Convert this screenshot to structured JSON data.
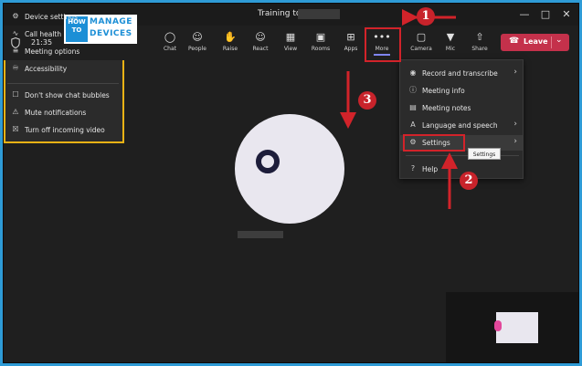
{
  "window": {
    "title": "Training to",
    "controls": [
      "minimize-icon",
      "maximize-icon",
      "close-icon"
    ]
  },
  "branding": {
    "logo_left": "HOW TO",
    "logo_top": "MANAGE",
    "logo_bottom": "DEVICES"
  },
  "toolbar": {
    "clock": "21:35",
    "buttons": [
      {
        "label": "Chat",
        "icon": "chat-icon"
      },
      {
        "label": "People",
        "icon": "people-icon"
      },
      {
        "label": "Raise",
        "icon": "hand-icon"
      },
      {
        "label": "React",
        "icon": "smile-icon"
      },
      {
        "label": "View",
        "icon": "grid-icon"
      },
      {
        "label": "Rooms",
        "icon": "rooms-icon"
      },
      {
        "label": "Apps",
        "icon": "plus-icon"
      },
      {
        "label": "More",
        "icon": "ellipsis-icon"
      },
      {
        "label": "Camera",
        "icon": "camera-icon"
      },
      {
        "label": "Mic",
        "icon": "mic-icon"
      },
      {
        "label": "Share",
        "icon": "share-icon"
      }
    ],
    "leave_label": "Leave"
  },
  "more_menu": {
    "items": [
      {
        "label": "Record and transcribe",
        "icon": "record-icon",
        "submenu": true
      },
      {
        "label": "Meeting info",
        "icon": "info-icon",
        "submenu": false
      },
      {
        "label": "Meeting notes",
        "icon": "notes-icon",
        "submenu": false
      },
      {
        "label": "Language and speech",
        "icon": "language-icon",
        "submenu": true
      },
      {
        "label": "Settings",
        "icon": "gear-icon",
        "submenu": true
      },
      {
        "label": "Help",
        "icon": "help-icon",
        "submenu": false
      }
    ],
    "tooltip": "Settings"
  },
  "settings_menu": {
    "items": [
      {
        "label": "Device settings",
        "icon": "device-settings-icon"
      },
      {
        "label": "Call health",
        "icon": "call-health-icon"
      },
      {
        "label": "Meeting options",
        "icon": "meeting-options-icon"
      },
      {
        "label": "Accessibility",
        "icon": "accessibility-icon"
      },
      {
        "label": "Don't show chat bubbles",
        "icon": "chat-bubble-off-icon"
      },
      {
        "label": "Mute notifications",
        "icon": "bell-off-icon"
      },
      {
        "label": "Turn off incoming video",
        "icon": "video-off-icon"
      }
    ]
  },
  "annotations": {
    "steps": [
      "1",
      "2",
      "3"
    ],
    "colors": {
      "annotation": "#d2232a",
      "highlight": "#e9b215",
      "leave": "#c4314b",
      "accent": "#7f85f5"
    }
  }
}
